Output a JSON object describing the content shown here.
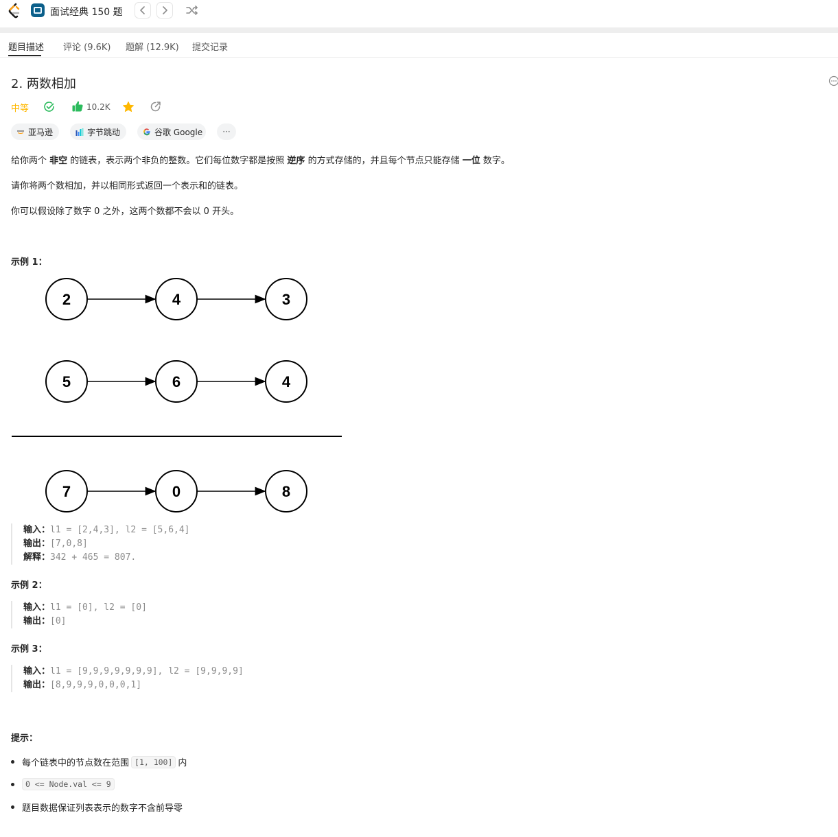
{
  "topbar": {
    "study_plan_title": "面试经典 150 题",
    "prev_icon": "chevron-left-icon",
    "next_icon": "chevron-right-icon",
    "shuffle_icon": "shuffle-icon"
  },
  "tabs": [
    {
      "label": "题目描述",
      "active": true
    },
    {
      "label": "评论 (9.6K)",
      "active": false
    },
    {
      "label": "题解 (12.9K)",
      "active": false
    },
    {
      "label": "提交记录",
      "active": false
    }
  ],
  "problem": {
    "title": "2. 两数相加",
    "difficulty": "中等",
    "likes": "10.2K",
    "colors": {
      "difficulty": "#ffb800",
      "solved": "#2cbb5d",
      "like": "#2cbb5d",
      "star": "#ffb800"
    }
  },
  "company_tags": [
    "亚马逊",
    "字节跳动",
    "谷歌 Google",
    "···"
  ],
  "description": {
    "p1_a": "给你两个 ",
    "p1_b": "非空",
    "p1_c": " 的链表，表示两个非负的整数。它们每位数字都是按照 ",
    "p1_d": "逆序",
    "p1_e": " 的方式存储的，并且每个节点只能存储 ",
    "p1_f": "一位",
    "p1_g": " 数字。",
    "p2": "请你将两个数相加，并以相同形式返回一个表示和的链表。",
    "p3": "你可以假设除了数字 0 之外，这两个数都不会以 0 开头。"
  },
  "examples": [
    {
      "heading": "示例 1：",
      "diagram": {
        "list1": [
          "2",
          "4",
          "3"
        ],
        "list2": [
          "5",
          "6",
          "4"
        ],
        "result": [
          "7",
          "0",
          "8"
        ]
      },
      "input_label": "输入：",
      "input": "l1 = [2,4,3], l2 = [5,6,4]",
      "output_label": "输出：",
      "output": "[7,0,8]",
      "explain_label": "解释：",
      "explain": "342 + 465 = 807."
    },
    {
      "heading": "示例 2：",
      "input_label": "输入：",
      "input": "l1 = [0], l2 = [0]",
      "output_label": "输出：",
      "output": "[0]"
    },
    {
      "heading": "示例 3：",
      "input_label": "输入：",
      "input": "l1 = [9,9,9,9,9,9,9], l2 = [9,9,9,9]",
      "output_label": "输出：",
      "output": "[8,9,9,9,0,0,0,1]"
    }
  ],
  "hints": {
    "heading": "提示：",
    "h1_a": "每个链表中的节点数在范围 ",
    "h1_code": "[1, 100]",
    "h1_b": " 内",
    "h2_code": "0 <= Node.val <= 9",
    "h3": "题目数据保证列表表示的数字不含前导零"
  }
}
